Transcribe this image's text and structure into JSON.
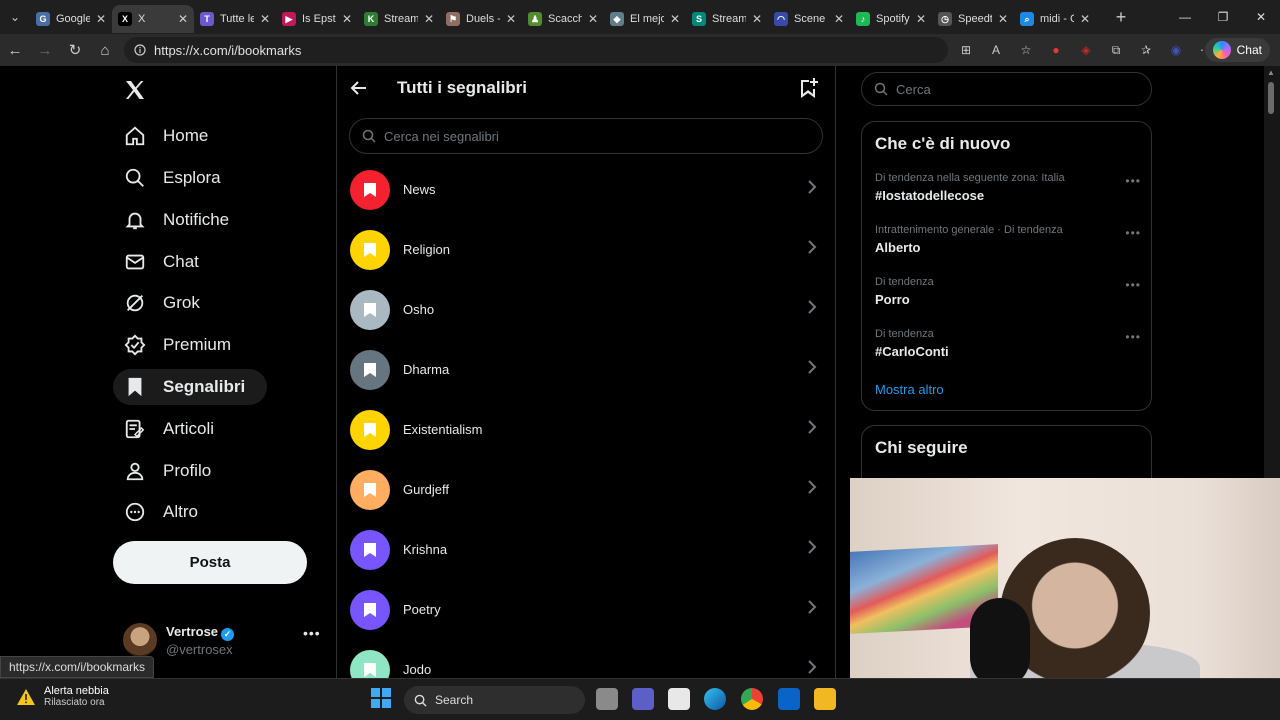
{
  "browser": {
    "tabs": [
      {
        "label": "Google",
        "color": "#4a6fa5",
        "glyph": "G",
        "active": false
      },
      {
        "label": "X",
        "color": "#000000",
        "glyph": "X",
        "active": true
      },
      {
        "label": "Tutte le",
        "color": "#6a5acd",
        "glyph": "T",
        "active": false
      },
      {
        "label": "Is Epste",
        "color": "#c2185b",
        "glyph": "▶",
        "active": false
      },
      {
        "label": "Stream",
        "color": "#2e7d32",
        "glyph": "K",
        "active": false
      },
      {
        "label": "Duels -",
        "color": "#8d6e63",
        "glyph": "⚑",
        "active": false
      },
      {
        "label": "Scacchi",
        "color": "#558b2f",
        "glyph": "♟",
        "active": false
      },
      {
        "label": "El mejo",
        "color": "#607d8b",
        "glyph": "◆",
        "active": false
      },
      {
        "label": "Streaml",
        "color": "#00897b",
        "glyph": "S",
        "active": false
      },
      {
        "label": "Scene E",
        "color": "#3949ab",
        "glyph": "◠",
        "active": false
      },
      {
        "label": "Spotify",
        "color": "#1db954",
        "glyph": "♪",
        "active": false
      },
      {
        "label": "Speedtu",
        "color": "#555555",
        "glyph": "◷",
        "active": false
      },
      {
        "label": "midi - C",
        "color": "#1e88e5",
        "glyph": "⌕",
        "active": false
      }
    ],
    "url": "https://x.com/i/bookmarks",
    "chat_label": "Chat",
    "status_url": "https://x.com/i/bookmarks"
  },
  "sidebar": {
    "items": [
      {
        "label": "Home",
        "icon": "home-icon",
        "name": "sidebar-item-home"
      },
      {
        "label": "Esplora",
        "icon": "search-icon",
        "name": "sidebar-item-esplora"
      },
      {
        "label": "Notifiche",
        "icon": "bell-icon",
        "name": "sidebar-item-notifiche"
      },
      {
        "label": "Chat",
        "icon": "mail-icon",
        "name": "sidebar-item-chat"
      },
      {
        "label": "Grok",
        "icon": "grok-icon",
        "name": "sidebar-item-grok"
      },
      {
        "label": "Premium",
        "icon": "verified-badge-icon",
        "name": "sidebar-item-premium"
      },
      {
        "label": "Segnalibri",
        "icon": "bookmark-icon",
        "name": "sidebar-item-segnalibri",
        "active": true
      },
      {
        "label": "Articoli",
        "icon": "article-icon",
        "name": "sidebar-item-articoli"
      },
      {
        "label": "Profilo",
        "icon": "person-icon",
        "name": "sidebar-item-profilo"
      },
      {
        "label": "Altro",
        "icon": "more-circle-icon",
        "name": "sidebar-item-altro"
      }
    ],
    "post_label": "Posta",
    "account": {
      "name": "Vertrose",
      "handle": "@vertrosex"
    }
  },
  "main": {
    "title": "Tutti i segnalibri",
    "search_placeholder": "Cerca nei segnalibri",
    "folders": [
      {
        "name": "News",
        "color": "#f4212e"
      },
      {
        "name": "Religion",
        "color": "#ffd400"
      },
      {
        "name": "Osho",
        "color": "#aab8c2"
      },
      {
        "name": "Dharma",
        "color": "#66757f"
      },
      {
        "name": "Existentialism",
        "color": "#ffd400"
      },
      {
        "name": "Gurdjeff",
        "color": "#ffad60"
      },
      {
        "name": "Krishna",
        "color": "#7856ff"
      },
      {
        "name": "Poetry",
        "color": "#7856ff"
      },
      {
        "name": "Jodo",
        "color": "#8ee6c4"
      }
    ]
  },
  "right": {
    "search_placeholder": "Cerca",
    "trends_title": "Che c'è di nuovo",
    "trends": [
      {
        "context": "Di tendenza nella seguente zona: Italia",
        "name": "#Iostatodellecose"
      },
      {
        "context": "Intrattenimento generale · Di tendenza",
        "name": "Alberto"
      },
      {
        "context": "Di tendenza",
        "name": "Porro"
      },
      {
        "context": "Di tendenza",
        "name": "#CarloConti"
      }
    ],
    "show_more": "Mostra altro",
    "who_to_follow_title": "Chi seguire"
  },
  "taskbar": {
    "weather_title": "Alerta nebbia",
    "weather_sub": "Rilasciato ora",
    "search_label": "Search"
  },
  "colors": {
    "accent": "#1d9bf0",
    "background": "#000000",
    "border": "#2f3336"
  }
}
